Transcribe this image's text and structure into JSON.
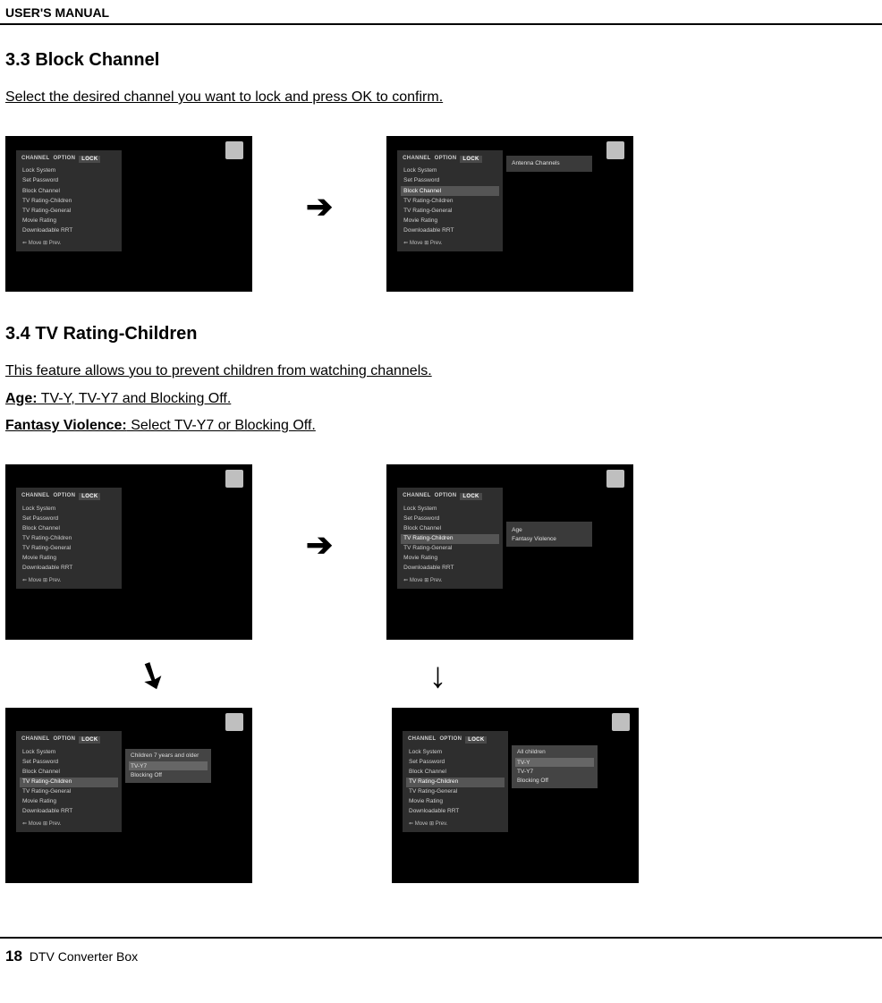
{
  "header": {
    "title": "USER'S MANUAL"
  },
  "s33": {
    "heading": "3.3 Block Channel",
    "desc": "Select the desired channel you want to lock and press OK to confirm."
  },
  "s34": {
    "heading": "3.4 TV Rating-Children",
    "desc": "This feature allows you to prevent children from watching channels.",
    "age_label": "Age:",
    "age_text": " TV-Y, TV-Y7 and Blocking Off.",
    "fv_label": "Fantasy Violence:",
    "fv_text": " Select TV-Y7 or Blocking Off."
  },
  "tabs": {
    "channel": "CHANNEL",
    "option": "OPTION",
    "lock": "LOCK"
  },
  "menu": {
    "lock_system": "Lock System",
    "set_password": "Set Password",
    "block_channel": "Block Channel",
    "tv_rating_children": "TV Rating-Children",
    "tv_rating_general": "TV Rating-General",
    "movie_rating": "Movie Rating",
    "downloadable_rrt": "Downloadable RRT",
    "hint": "⇐ Move  ⊞ Prev."
  },
  "side": {
    "antenna_channels": "Antenna Channels",
    "age": "Age",
    "fantasy_violence": "Fantasy Violence",
    "all_children": "All children",
    "children_7_older": "Children 7 years and older",
    "tv_y": "TV-Y",
    "tv_y7": "TV-Y7",
    "blocking_off": "Blocking Off"
  },
  "footer": {
    "page": "18",
    "product": "DTV Converter Box"
  }
}
